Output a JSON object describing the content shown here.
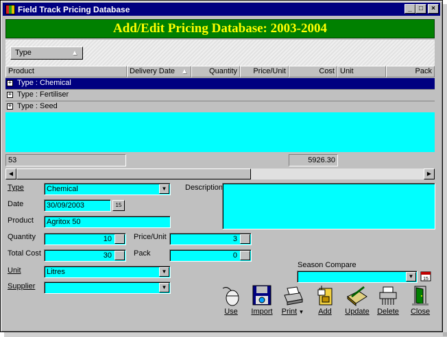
{
  "window": {
    "title": "Field Track Pricing Database"
  },
  "banner": "Add/Edit Pricing Database: 2003-2004",
  "group_by": {
    "label": "Type"
  },
  "grid": {
    "columns": [
      "Product",
      "Delivery Date",
      "Quantity",
      "Price/Unit",
      "Cost",
      "Unit",
      "Pack"
    ],
    "groups": [
      "Type : Chemical",
      "Type : Fertiliser",
      "Type : Seed"
    ],
    "footer_count": "53",
    "footer_cost": "5926.30"
  },
  "form": {
    "type_label": "Type",
    "type_value": "Chemical",
    "date_label": "Date",
    "date_value": "30/09/2003",
    "calendar_label": "15",
    "product_label": "Product",
    "product_value": "Agritox 50",
    "quantity_label": "Quantity",
    "quantity_value": "10",
    "price_unit_label": "Price/Unit",
    "price_unit_value": "3",
    "total_cost_label": "Total Cost",
    "total_cost_value": "30",
    "pack_label": "Pack",
    "pack_value": "0",
    "unit_label": "Unit",
    "unit_value": "Litres",
    "supplier_label": "Supplier",
    "supplier_value": "",
    "description_label": "Description",
    "description_value": "",
    "season_compare_label": "Season Compare",
    "season_compare_value": ""
  },
  "toolbar": {
    "use": "Use",
    "import": "Import",
    "print": "Print",
    "add": "Add",
    "update": "Update",
    "delete": "Delete",
    "close": "Close"
  },
  "colors": {
    "field": "#00ffff",
    "banner_bg": "#008000",
    "banner_text": "#ffff00",
    "titlebar": "#000080"
  }
}
